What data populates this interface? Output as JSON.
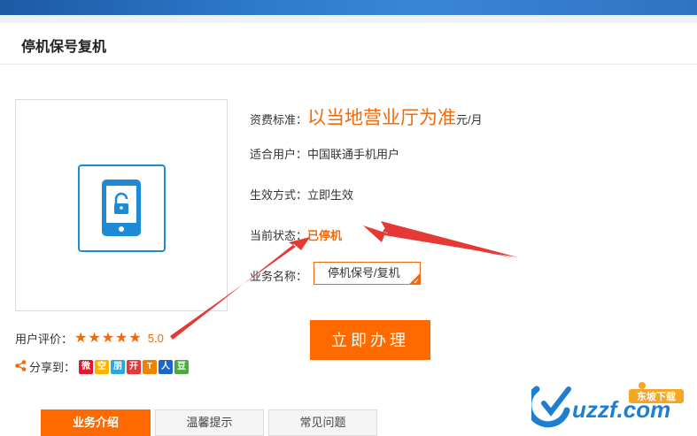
{
  "header": {
    "title": "停机保号复机"
  },
  "product": {
    "price_label": "资费标准：",
    "price_value": "以当地营业厅为准",
    "price_unit": "元/月",
    "users_label": "适合用户：",
    "users_value": "中国联通手机用户",
    "effect_label": "生效方式：",
    "effect_value": "立即生效",
    "status_label": "当前状态：",
    "status_value": "已停机",
    "biz_label": "业务名称：",
    "biz_value": "停机保号/复机",
    "apply_label": "立即办理"
  },
  "rating": {
    "label": "用户评价：",
    "stars": "★★★★★",
    "score": "5.0"
  },
  "share": {
    "label": "分享到：",
    "buttons": [
      {
        "name": "weibo",
        "glyph": "微",
        "color": "#e6162d"
      },
      {
        "name": "qzone",
        "glyph": "空",
        "color": "#f7b500"
      },
      {
        "name": "pengyou",
        "glyph": "朋",
        "color": "#2aa7e0"
      },
      {
        "name": "kaixin",
        "glyph": "开",
        "color": "#e4393c"
      },
      {
        "name": "tianya",
        "glyph": "T",
        "color": "#f08200"
      },
      {
        "name": "renren",
        "glyph": "人",
        "color": "#1b66c9"
      },
      {
        "name": "douban",
        "glyph": "豆",
        "color": "#4ca943"
      }
    ]
  },
  "tabs": [
    {
      "label": "业务介绍"
    },
    {
      "label": "温馨提示"
    },
    {
      "label": "常见问题"
    }
  ],
  "watermark": {
    "brand": "uzzf.com",
    "sub": "东坡下载"
  },
  "colors": {
    "accent": "#ff6a00",
    "brand_blue": "#1e8ad6",
    "annotation_red": "#e53935"
  },
  "icons": {
    "product": "phone-unlock-icon",
    "share": "share-icon"
  }
}
